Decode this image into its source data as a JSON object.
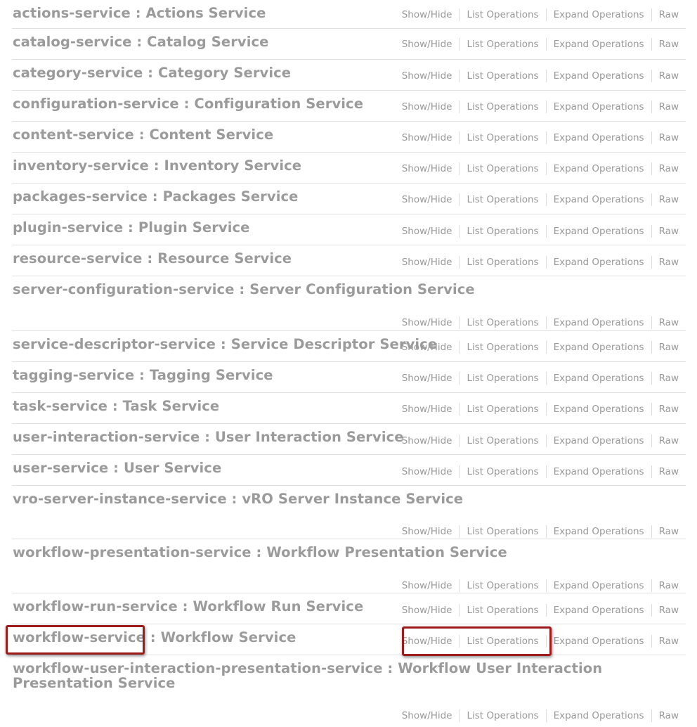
{
  "operations": {
    "show_hide": "Show/Hide",
    "list_operations": "List Operations",
    "expand_operations": "Expand Operations",
    "raw": "Raw"
  },
  "services": [
    {
      "id": "actions-service",
      "name": "actions-service",
      "separator": " : ",
      "description": "Actions Service"
    },
    {
      "id": "catalog-service",
      "name": "catalog-service",
      "separator": " : ",
      "description": "Catalog Service"
    },
    {
      "id": "category-service",
      "name": "category-service",
      "separator": " : ",
      "description": "Category Service"
    },
    {
      "id": "configuration-service",
      "name": "configuration-service",
      "separator": " : ",
      "description": "Configuration Service"
    },
    {
      "id": "content-service",
      "name": "content-service",
      "separator": " : ",
      "description": "Content Service"
    },
    {
      "id": "inventory-service",
      "name": "inventory-service",
      "separator": " : ",
      "description": "Inventory Service"
    },
    {
      "id": "packages-service",
      "name": "packages-service",
      "separator": " : ",
      "description": "Packages Service"
    },
    {
      "id": "plugin-service",
      "name": "plugin-service",
      "separator": " : ",
      "description": "Plugin Service"
    },
    {
      "id": "resource-service",
      "name": "resource-service",
      "separator": " : ",
      "description": "Resource Service"
    },
    {
      "id": "server-configuration-service",
      "name": "server-configuration-service",
      "separator": " : ",
      "description": "Server Configuration Service"
    },
    {
      "id": "service-descriptor-service",
      "name": "service-descriptor-service",
      "separator": " : ",
      "description": "Service Descriptor Service"
    },
    {
      "id": "tagging-service",
      "name": "tagging-service",
      "separator": " : ",
      "description": "Tagging Service"
    },
    {
      "id": "task-service",
      "name": "task-service",
      "separator": " : ",
      "description": "Task Service"
    },
    {
      "id": "user-interaction-service",
      "name": "user-interaction-service",
      "separator": " : ",
      "description": "User Interaction Service"
    },
    {
      "id": "user-service",
      "name": "user-service",
      "separator": " : ",
      "description": "User Service"
    },
    {
      "id": "vro-server-instance-service",
      "name": "vro-server-instance-service",
      "separator": " : ",
      "description": "vRO Server Instance Service"
    },
    {
      "id": "workflow-presentation-service",
      "name": "workflow-presentation-service",
      "separator": " : ",
      "description": "Workflow Presentation Service"
    },
    {
      "id": "workflow-run-service",
      "name": "workflow-run-service",
      "separator": " : ",
      "description": "Workflow Run Service"
    },
    {
      "id": "workflow-service",
      "name": "workflow-service",
      "separator": " : ",
      "description": "Workflow Service"
    },
    {
      "id": "workflow-user-interaction-presentation-service",
      "name": "workflow-user-interaction-presentation-service",
      "separator": " : ",
      "description": "Workflow User Interaction Presentation Service"
    }
  ],
  "colors": {
    "title_text": "#9b9b9b",
    "link_text": "#999999",
    "row_divider": "#e0e0e0",
    "highlight_border": "#9e1b1b"
  }
}
